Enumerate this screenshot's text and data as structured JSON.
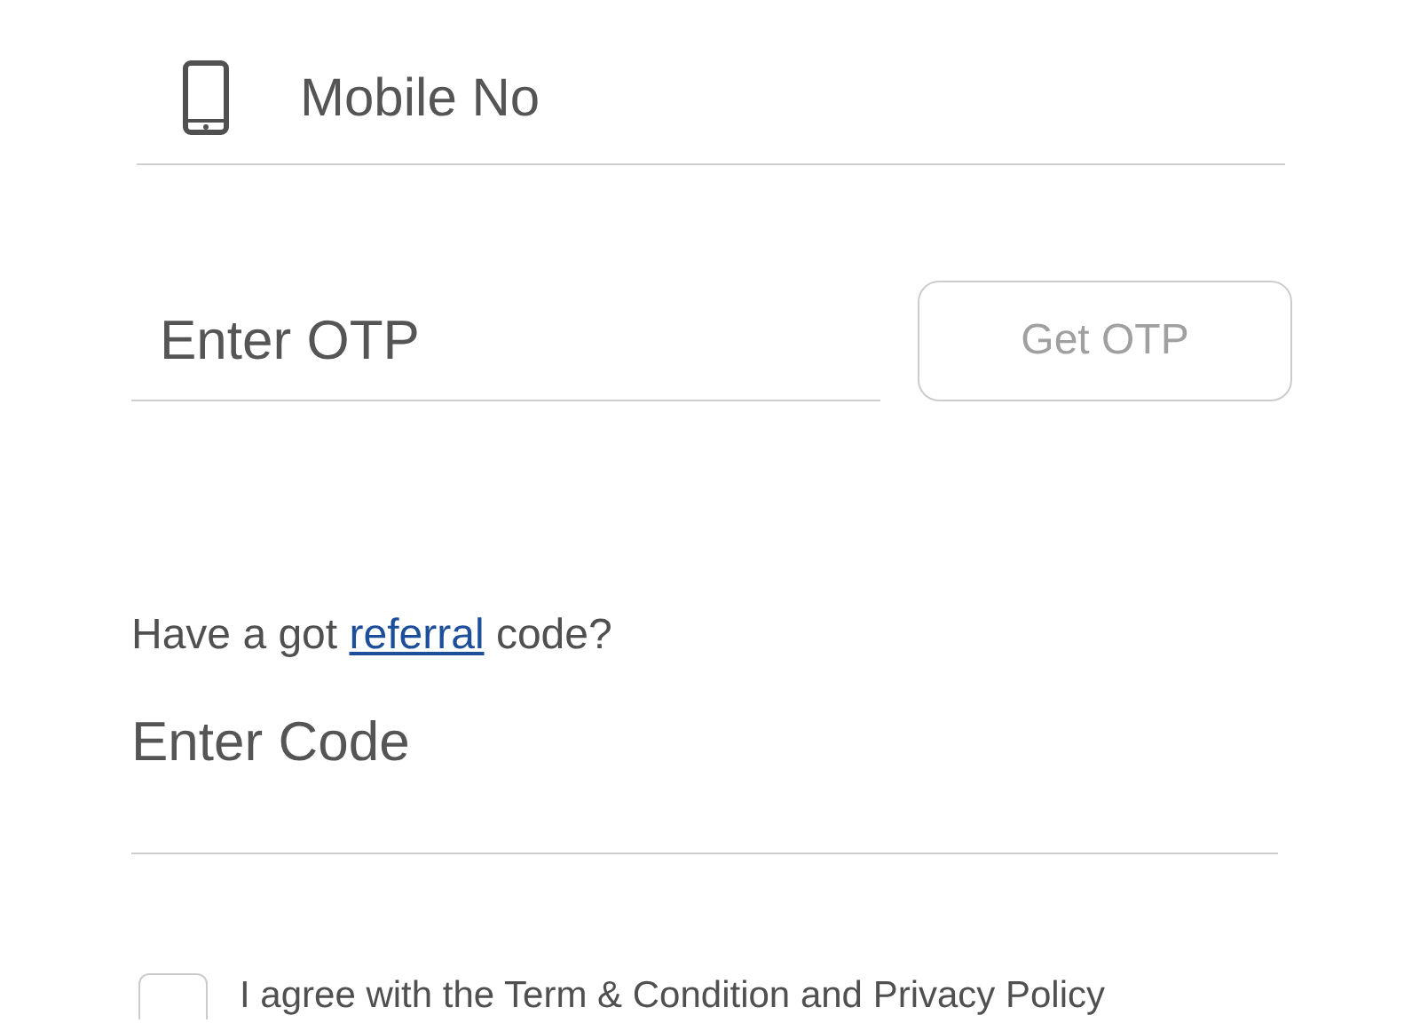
{
  "mobile_field": {
    "placeholder": "Mobile No"
  },
  "otp_field": {
    "placeholder": "Enter OTP"
  },
  "get_otp_button": {
    "label": "Get OTP",
    "disabled": true
  },
  "referral": {
    "before": "Have a got ",
    "link": "referral",
    "after": " code?"
  },
  "code_field": {
    "placeholder": "Enter Code"
  },
  "terms": {
    "label": "I agree with the Term & Condition and Privacy Policy",
    "checked": false
  }
}
